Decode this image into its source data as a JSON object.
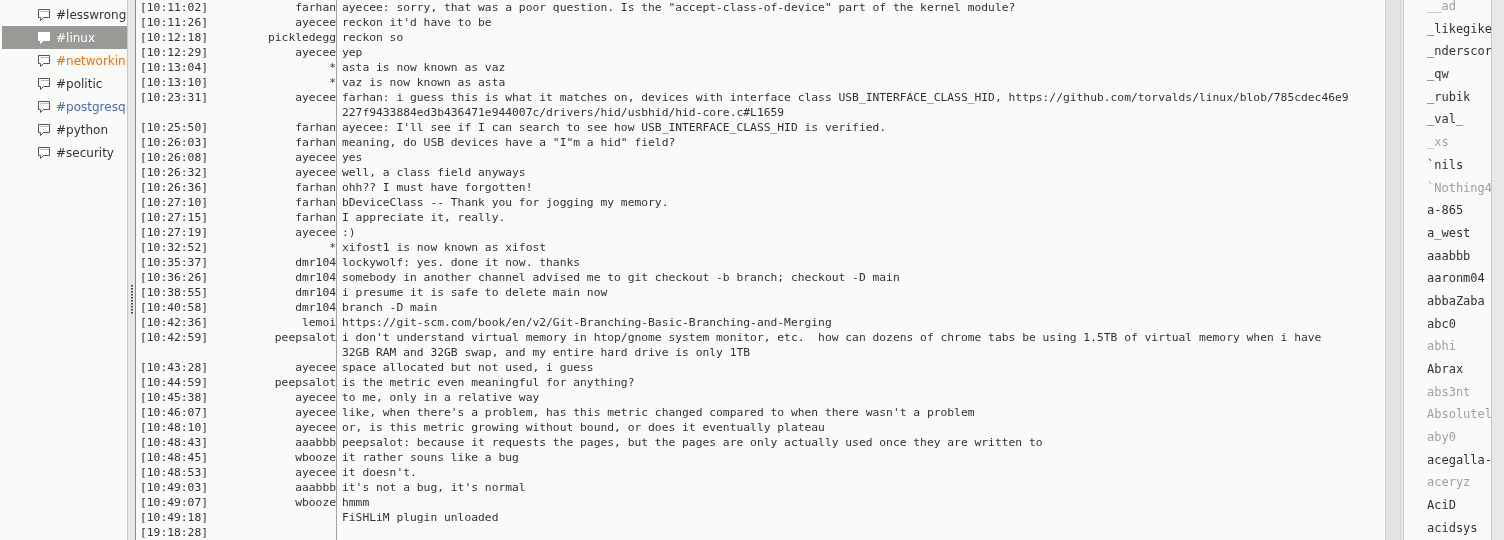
{
  "channels": [
    {
      "name": "#lesswrong",
      "selected": false
    },
    {
      "name": "#linux",
      "selected": true
    },
    {
      "name": "#networkin",
      "selected": false,
      "color": "#e8740c"
    },
    {
      "name": "#politic",
      "selected": false
    },
    {
      "name": "#postgresq",
      "selected": false,
      "color": "#4a6cb0"
    },
    {
      "name": "#python",
      "selected": false
    },
    {
      "name": "#security",
      "selected": false
    }
  ],
  "messages": [
    {
      "time": "[10:11:02]",
      "nick": "farhan",
      "lines": [
        "ayecee: sorry, that was a poor question. Is the \"accept-class-of-device\" part of the kernel module?"
      ]
    },
    {
      "time": "[10:11:26]",
      "nick": "ayecee",
      "lines": [
        "reckon it'd have to be"
      ]
    },
    {
      "time": "[10:12:18]",
      "nick": "pickledegg",
      "lines": [
        "reckon so"
      ]
    },
    {
      "time": "[10:12:29]",
      "nick": "ayecee",
      "lines": [
        "yep"
      ]
    },
    {
      "time": "[10:13:04]",
      "nick": "*",
      "lines": [
        "asta is now known as vaz"
      ]
    },
    {
      "time": "[10:13:10]",
      "nick": "*",
      "lines": [
        "vaz is now known as asta"
      ]
    },
    {
      "time": "[10:23:31]",
      "nick": "ayecee",
      "lines": [
        "farhan: i guess this is what it matches on, devices with interface class USB_INTERFACE_CLASS_HID, https://github.com/torvalds/linux/blob/785cdec46e9",
        "227f9433884ed3b436471e944007c/drivers/hid/usbhid/hid-core.c#L1659"
      ]
    },
    {
      "time": "[10:25:50]",
      "nick": "farhan",
      "lines": [
        "ayecee: I'll see if I can search to see how USB_INTERFACE_CLASS_HID is verified."
      ]
    },
    {
      "time": "[10:26:03]",
      "nick": "farhan",
      "lines": [
        "meaning, do USB devices have a \"I\"m a hid\" field?"
      ]
    },
    {
      "time": "[10:26:08]",
      "nick": "ayecee",
      "lines": [
        "yes"
      ]
    },
    {
      "time": "[10:26:32]",
      "nick": "ayecee",
      "lines": [
        "well, a class field anyways"
      ]
    },
    {
      "time": "[10:26:36]",
      "nick": "farhan",
      "lines": [
        "ohh?? I must have forgotten!"
      ]
    },
    {
      "time": "[10:27:10]",
      "nick": "farhan",
      "lines": [
        "bDeviceClass -- Thank you for jogging my memory."
      ]
    },
    {
      "time": "[10:27:15]",
      "nick": "farhan",
      "lines": [
        "I appreciate it, really."
      ]
    },
    {
      "time": "[10:27:19]",
      "nick": "ayecee",
      "lines": [
        ":)"
      ]
    },
    {
      "time": "[10:32:52]",
      "nick": "*",
      "lines": [
        "xifost1 is now known as xifost"
      ]
    },
    {
      "time": "[10:35:37]",
      "nick": "dmr104",
      "lines": [
        "lockywolf: yes. done it now. thanks"
      ]
    },
    {
      "time": "[10:36:26]",
      "nick": "dmr104",
      "lines": [
        "somebody in another channel advised me to git checkout -b branch; checkout -D main"
      ]
    },
    {
      "time": "[10:38:55]",
      "nick": "dmr104",
      "lines": [
        "i presume it is safe to delete main now"
      ]
    },
    {
      "time": "[10:40:58]",
      "nick": "dmr104",
      "lines": [
        "branch -D main"
      ]
    },
    {
      "time": "[10:42:36]",
      "nick": "lemoi",
      "lines": [
        "https://git-scm.com/book/en/v2/Git-Branching-Basic-Branching-and-Merging"
      ]
    },
    {
      "time": "[10:42:59]",
      "nick": "peepsalot",
      "lines": [
        "i don't understand virtual memory in htop/gnome system monitor, etc.  how can dozens of chrome tabs be using 1.5TB of virtual memory when i have",
        "32GB RAM and 32GB swap, and my entire hard drive is only 1TB"
      ]
    },
    {
      "time": "[10:43:28]",
      "nick": "ayecee",
      "lines": [
        "space allocated but not used, i guess"
      ]
    },
    {
      "time": "[10:44:59]",
      "nick": "peepsalot",
      "lines": [
        "is the metric even meaningful for anything?"
      ]
    },
    {
      "time": "[10:45:38]",
      "nick": "ayecee",
      "lines": [
        "to me, only in a relative way"
      ]
    },
    {
      "time": "[10:46:07]",
      "nick": "ayecee",
      "lines": [
        "like, when there's a problem, has this metric changed compared to when there wasn't a problem"
      ]
    },
    {
      "time": "[10:48:10]",
      "nick": "ayecee",
      "lines": [
        "or, is this metric growing without bound, or does it eventually plateau"
      ]
    },
    {
      "time": "[10:48:43]",
      "nick": "aaabbb",
      "lines": [
        "peepsalot: because it requests the pages, but the pages are only actually used once they are written to"
      ]
    },
    {
      "time": "[10:48:45]",
      "nick": "wbooze",
      "lines": [
        "it rather souns like a bug"
      ]
    },
    {
      "time": "[10:48:53]",
      "nick": "ayecee",
      "lines": [
        "it doesn't."
      ]
    },
    {
      "time": "[10:49:03]",
      "nick": "aaabbb",
      "lines": [
        "it's not a bug, it's normal"
      ]
    },
    {
      "time": "[10:49:07]",
      "nick": "wbooze",
      "lines": [
        "hmmm"
      ]
    },
    {
      "time": "[10:49:18]",
      "lines": [
        "FiSHLiM plugin unloaded"
      ]
    },
    {
      "time": "[19:18:28]"
    }
  ],
  "users": [
    {
      "name": "__ad",
      "away": true
    },
    {
      "name": "_likegike",
      "away": false
    },
    {
      "name": "_nderscor",
      "away": false
    },
    {
      "name": "_qw",
      "away": false
    },
    {
      "name": "_rubik",
      "away": false
    },
    {
      "name": "_val_",
      "away": false
    },
    {
      "name": "_xs",
      "away": true
    },
    {
      "name": "`nils",
      "away": false
    },
    {
      "name": "`Nothing4",
      "away": true
    },
    {
      "name": "a-865",
      "away": false
    },
    {
      "name": "a_west",
      "away": false
    },
    {
      "name": "aaabbb",
      "away": false
    },
    {
      "name": "aaronm04",
      "away": false
    },
    {
      "name": "abbaZaba",
      "away": false
    },
    {
      "name": "abc0",
      "away": false
    },
    {
      "name": "abhi",
      "away": true
    },
    {
      "name": "Abrax",
      "away": false
    },
    {
      "name": "abs3nt",
      "away": true
    },
    {
      "name": "Absolutel",
      "away": true
    },
    {
      "name": "aby0",
      "away": true
    },
    {
      "name": "acegalla-",
      "away": false
    },
    {
      "name": "aceryz",
      "away": true
    },
    {
      "name": "AciD",
      "away": false
    },
    {
      "name": "acidsys",
      "away": false
    }
  ]
}
